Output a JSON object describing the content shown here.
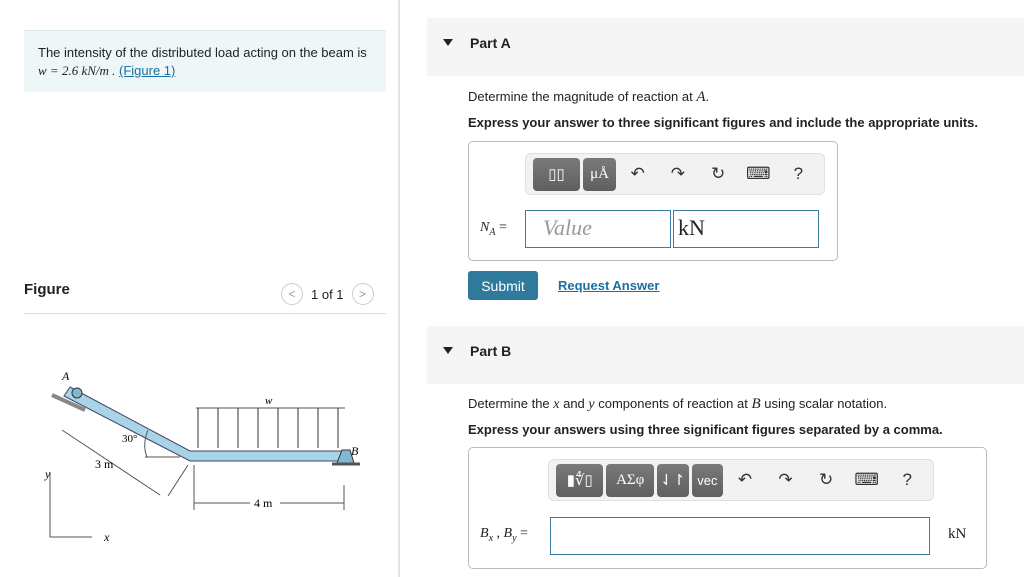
{
  "problem": {
    "text": "The intensity of the distributed load acting on the beam is",
    "equation": "w = 2.6  kN/m .",
    "figure_link": "(Figure 1)"
  },
  "figure_panel": {
    "title": "Figure",
    "pager": "1 of 1",
    "prev": "<",
    "next": ">",
    "labels": {
      "A": "A",
      "B": "B",
      "w": "w",
      "angle": "30°",
      "len1": "3 m",
      "len2": "4 m",
      "y": "y",
      "x": "x"
    }
  },
  "partA": {
    "title": "Part A",
    "question_pre": "Determine the magnitude of reaction at ",
    "question_var": "A",
    "question_post": ".",
    "instruction": "Express your answer to three significant figures and include the appropriate units.",
    "toolbar": {
      "templates": "▯▯",
      "units": "μÅ",
      "undo": "↶",
      "redo": "↷",
      "reset": "↻",
      "keyboard": "⌨",
      "help": "?"
    },
    "label_main": "N",
    "label_sub": "A",
    "eq": "=",
    "value_placeholder": "Value",
    "unit": "kN",
    "submit": "Submit",
    "request": "Request Answer"
  },
  "partB": {
    "title": "Part B",
    "question": "Determine the x and y components of reaction at B using scalar notation.",
    "q1": "Determine the ",
    "qx": "x",
    "q2": " and ",
    "qy": "y",
    "q3": " components of reaction at ",
    "qB": "B",
    "q4": " using scalar notation.",
    "instruction": "Express your answers using three significant figures separated by a comma.",
    "toolbar": {
      "templates": "▮∜▯",
      "greek": "ΑΣφ",
      "arrows": "⇃↾",
      "vec": "vec",
      "undo": "↶",
      "redo": "↷",
      "reset": "↻",
      "keyboard": "⌨",
      "help": "?"
    },
    "label": "Bx , By",
    "lbl_B1": "B",
    "lbl_x": "x",
    "lbl_B2": "B",
    "lbl_y": "y",
    "eq": "=",
    "unit": "kN",
    "value": ""
  },
  "colors": {
    "accent": "#2f7a9c",
    "beam": "#a9d3e6",
    "info_bg": "#eef6f8"
  }
}
